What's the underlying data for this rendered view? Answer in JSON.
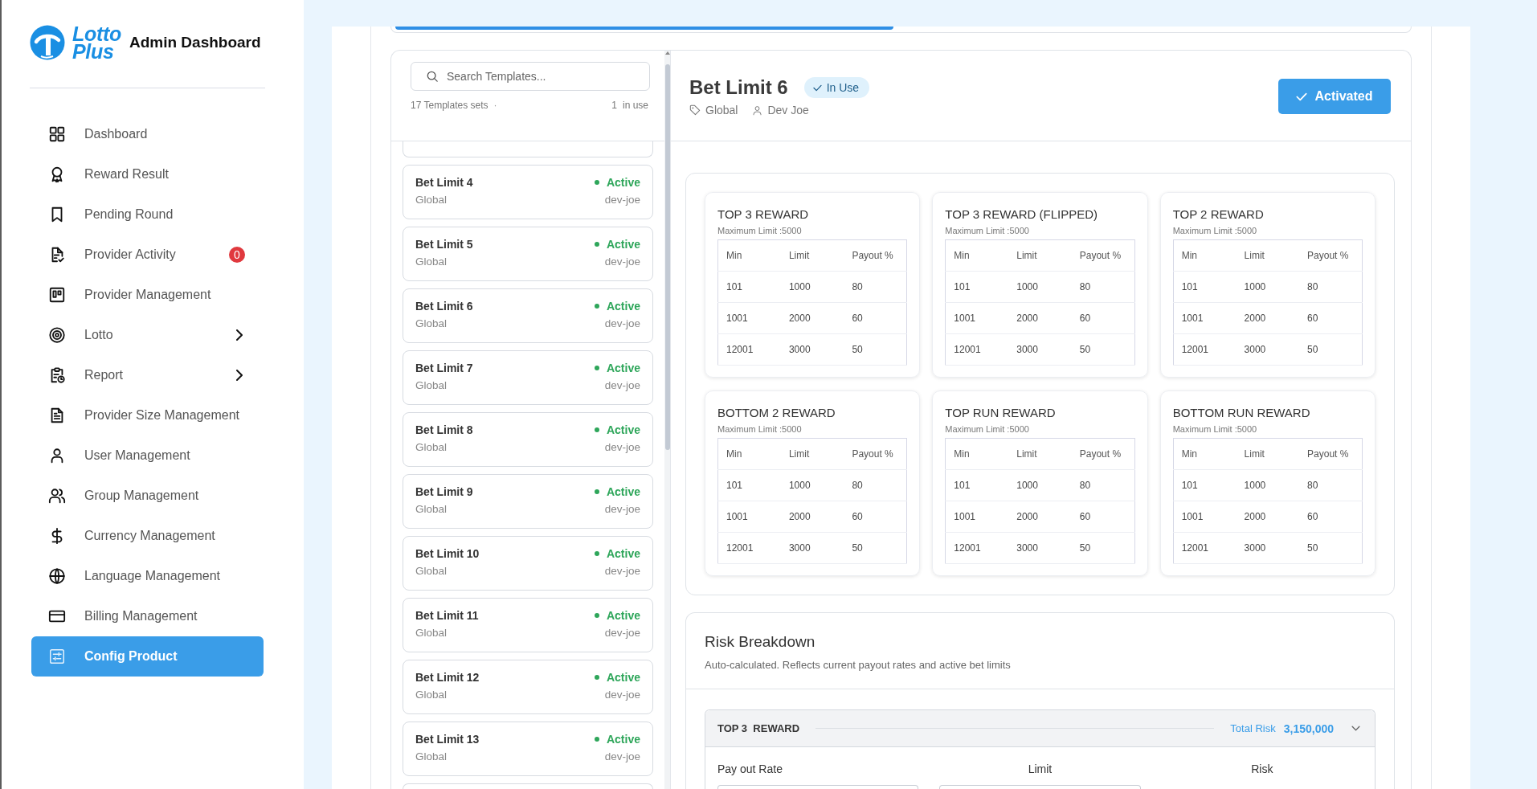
{
  "sidebar": {
    "logo": [
      "Lotto",
      "Plus"
    ],
    "title": "Admin Dashboard",
    "items": [
      {
        "label": "Dashboard",
        "selected": false,
        "has_submenu": false
      },
      {
        "label": "Reward Result",
        "selected": false,
        "has_submenu": false
      },
      {
        "label": "Pending Round",
        "selected": false,
        "has_submenu": false
      },
      {
        "label": "Provider Activity",
        "selected": false,
        "has_submenu": false,
        "badge": "0"
      },
      {
        "label": "Provider Management",
        "selected": false,
        "has_submenu": false
      },
      {
        "label": "Lotto",
        "selected": false,
        "has_submenu": true
      },
      {
        "label": "Report",
        "selected": false,
        "has_submenu": true
      },
      {
        "label": "Provider Size Management",
        "selected": false,
        "has_submenu": false
      },
      {
        "label": "User Management",
        "selected": false,
        "has_submenu": false
      },
      {
        "label": "Group Management",
        "selected": false,
        "has_submenu": false
      },
      {
        "label": "Currency Management",
        "selected": false,
        "has_submenu": false
      },
      {
        "label": "Language Management",
        "selected": false,
        "has_submenu": false
      },
      {
        "label": "Billing Management",
        "selected": false,
        "has_submenu": false
      },
      {
        "label": "Config Product",
        "selected": true,
        "has_submenu": false
      }
    ]
  },
  "templates": {
    "search": {
      "placeholder": "Search Templates..."
    },
    "count": "17 Templates sets",
    "separator": "·",
    "in_use_count": "1",
    "in_use_label": "in use",
    "items": [
      {
        "name": "Bet Limit 4",
        "scope": "Global",
        "status": "Active",
        "author": "dev-joe"
      },
      {
        "name": "Bet Limit 5",
        "scope": "Global",
        "status": "Active",
        "author": "dev-joe"
      },
      {
        "name": "Bet Limit 6",
        "scope": "Global",
        "status": "Active",
        "author": "dev-joe"
      },
      {
        "name": "Bet Limit 7",
        "scope": "Global",
        "status": "Active",
        "author": "dev-joe"
      },
      {
        "name": "Bet Limit 8",
        "scope": "Global",
        "status": "Active",
        "author": "dev-joe"
      },
      {
        "name": "Bet Limit 9",
        "scope": "Global",
        "status": "Active",
        "author": "dev-joe"
      },
      {
        "name": "Bet Limit 10",
        "scope": "Global",
        "status": "Active",
        "author": "dev-joe"
      },
      {
        "name": "Bet Limit 11",
        "scope": "Global",
        "status": "Active",
        "author": "dev-joe"
      },
      {
        "name": "Bet Limit 12",
        "scope": "Global",
        "status": "Active",
        "author": "dev-joe"
      },
      {
        "name": "Bet Limit 13",
        "scope": "Global",
        "status": "Active",
        "author": "dev-joe"
      }
    ]
  },
  "detail": {
    "title": "Bet Limit 6",
    "badge": "In Use",
    "scope": "Global",
    "author": "Dev Joe",
    "action": "Activated"
  },
  "rewards": [
    {
      "title": "TOP 3 REWARD",
      "max_limit": "Maximum Limit :5000",
      "columns": [
        "Min",
        "Limit",
        "Payout %"
      ],
      "rows": [
        [
          "101",
          "1000",
          "80"
        ],
        [
          "1001",
          "2000",
          "60"
        ],
        [
          "12001",
          "3000",
          "50"
        ]
      ]
    },
    {
      "title": "TOP 3 REWARD (FLIPPED)",
      "max_limit": "Maximum Limit :5000",
      "columns": [
        "Min",
        "Limit",
        "Payout %"
      ],
      "rows": [
        [
          "101",
          "1000",
          "80"
        ],
        [
          "1001",
          "2000",
          "60"
        ],
        [
          "12001",
          "3000",
          "50"
        ]
      ]
    },
    {
      "title": "TOP 2 REWARD",
      "max_limit": "Maximum Limit :5000",
      "columns": [
        "Min",
        "Limit",
        "Payout %"
      ],
      "rows": [
        [
          "101",
          "1000",
          "80"
        ],
        [
          "1001",
          "2000",
          "60"
        ],
        [
          "12001",
          "3000",
          "50"
        ]
      ]
    },
    {
      "title": "BOTTOM 2 REWARD",
      "max_limit": "Maximum Limit :5000",
      "columns": [
        "Min",
        "Limit",
        "Payout %"
      ],
      "rows": [
        [
          "101",
          "1000",
          "80"
        ],
        [
          "1001",
          "2000",
          "60"
        ],
        [
          "12001",
          "3000",
          "50"
        ]
      ]
    },
    {
      "title": "TOP RUN REWARD",
      "max_limit": "Maximum Limit :5000",
      "columns": [
        "Min",
        "Limit",
        "Payout %"
      ],
      "rows": [
        [
          "101",
          "1000",
          "80"
        ],
        [
          "1001",
          "2000",
          "60"
        ],
        [
          "12001",
          "3000",
          "50"
        ]
      ]
    },
    {
      "title": "BOTTOM RUN REWARD",
      "max_limit": "Maximum Limit :5000",
      "columns": [
        "Min",
        "Limit",
        "Payout %"
      ],
      "rows": [
        [
          "101",
          "1000",
          "80"
        ],
        [
          "1001",
          "2000",
          "60"
        ],
        [
          "12001",
          "3000",
          "50"
        ]
      ]
    }
  ],
  "risk": {
    "title": "Risk Breakdown",
    "subtitle": "Auto-calculated. Reflects current payout rates and active bet limits",
    "sections": [
      {
        "title": "TOP 3  REWARD",
        "total_label": "Total Risk",
        "total": "3,150,000",
        "expanded": true,
        "columns": [
          {
            "label": "Pay out Rate",
            "kind": "input"
          },
          {
            "label": "Limit",
            "kind": "input"
          },
          {
            "label": "Risk",
            "kind": "text"
          }
        ]
      }
    ]
  }
}
